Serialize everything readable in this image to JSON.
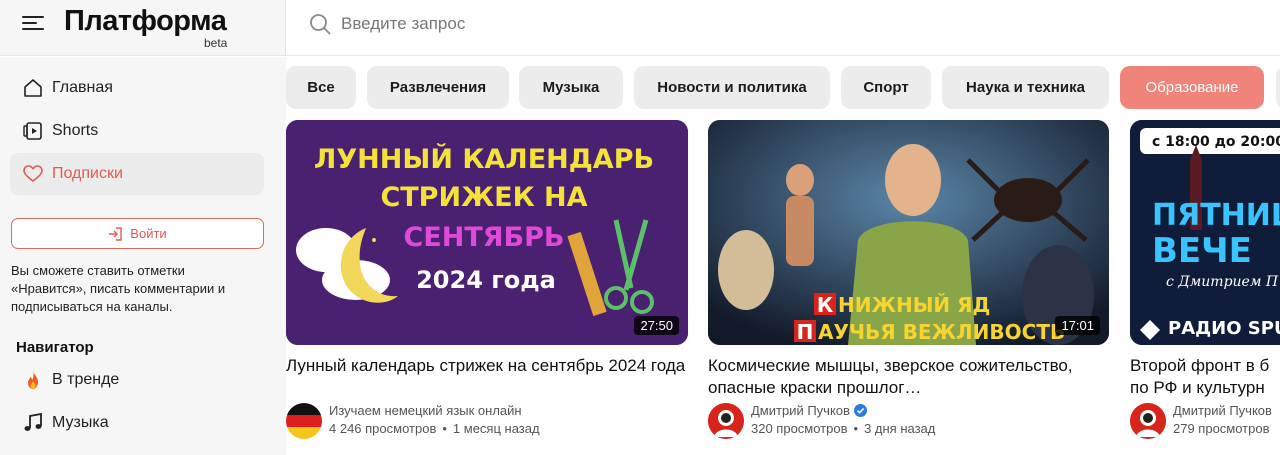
{
  "header": {
    "logo": "Платформа",
    "logo_badge": "beta",
    "search_placeholder": "Введите запрос"
  },
  "sidebar": {
    "items": [
      {
        "label": "Главная",
        "icon": "home-icon"
      },
      {
        "label": "Shorts",
        "icon": "shorts-icon"
      },
      {
        "label": "Подписки",
        "icon": "heart-icon",
        "active": true
      }
    ],
    "login_label": "Войти",
    "hint": "Вы сможете ставить отметки «Нравится», писать комментарии и подписываться на каналы.",
    "navigator_title": "Навигатор",
    "navigator_items": [
      {
        "label": "В тренде",
        "icon": "fire-icon"
      },
      {
        "label": "Музыка",
        "icon": "music-note-icon"
      }
    ]
  },
  "chips": [
    "Все",
    "Развлечения",
    "Музыка",
    "Новости и политика",
    "Спорт",
    "Наука и техника",
    "Образование"
  ],
  "active_chip": "Образование",
  "colors": {
    "accent": "#e15a52",
    "chip_active": "#f0837a",
    "chip_bg": "#ececec",
    "sidebar_bg": "#f6f6f6"
  },
  "videos": [
    {
      "thumb_lines": [
        "ЛУННЫЙ КАЛЕНДАРЬ",
        "СТРИЖЕК НА",
        "СЕНТЯБРЬ",
        "2024 года"
      ],
      "duration": "27:50",
      "title": "Лунный календарь стрижек на сентябрь 2024 года",
      "channel": "Изучаем немецкий язык онлайн",
      "views": "4 246 просмотров",
      "age": "1 месяц назад",
      "verified": false
    },
    {
      "thumb_lines": [
        "К",
        "НИЖНЫЙ ЯД",
        "П",
        "АУЧЬЯ ВЕЖЛИВОСТЬ"
      ],
      "duration": "17:01",
      "title": "Космические мышцы, зверское сожительство, опасные краски прошлог…",
      "channel": "Дмитрий Пучков",
      "views": "320 просмотров",
      "age": "3 дня назад",
      "verified": true
    },
    {
      "thumb_lines": [
        "с 18:00 до 20:00",
        "ПЯТНИЦ",
        "ВЕЧЕ",
        "с Дмитрием П",
        "РАДИО SPU"
      ],
      "title": "Второй фронт в б по РФ и культурн",
      "channel": "Дмитрий Пучков",
      "views": "279 просмотров"
    }
  ]
}
